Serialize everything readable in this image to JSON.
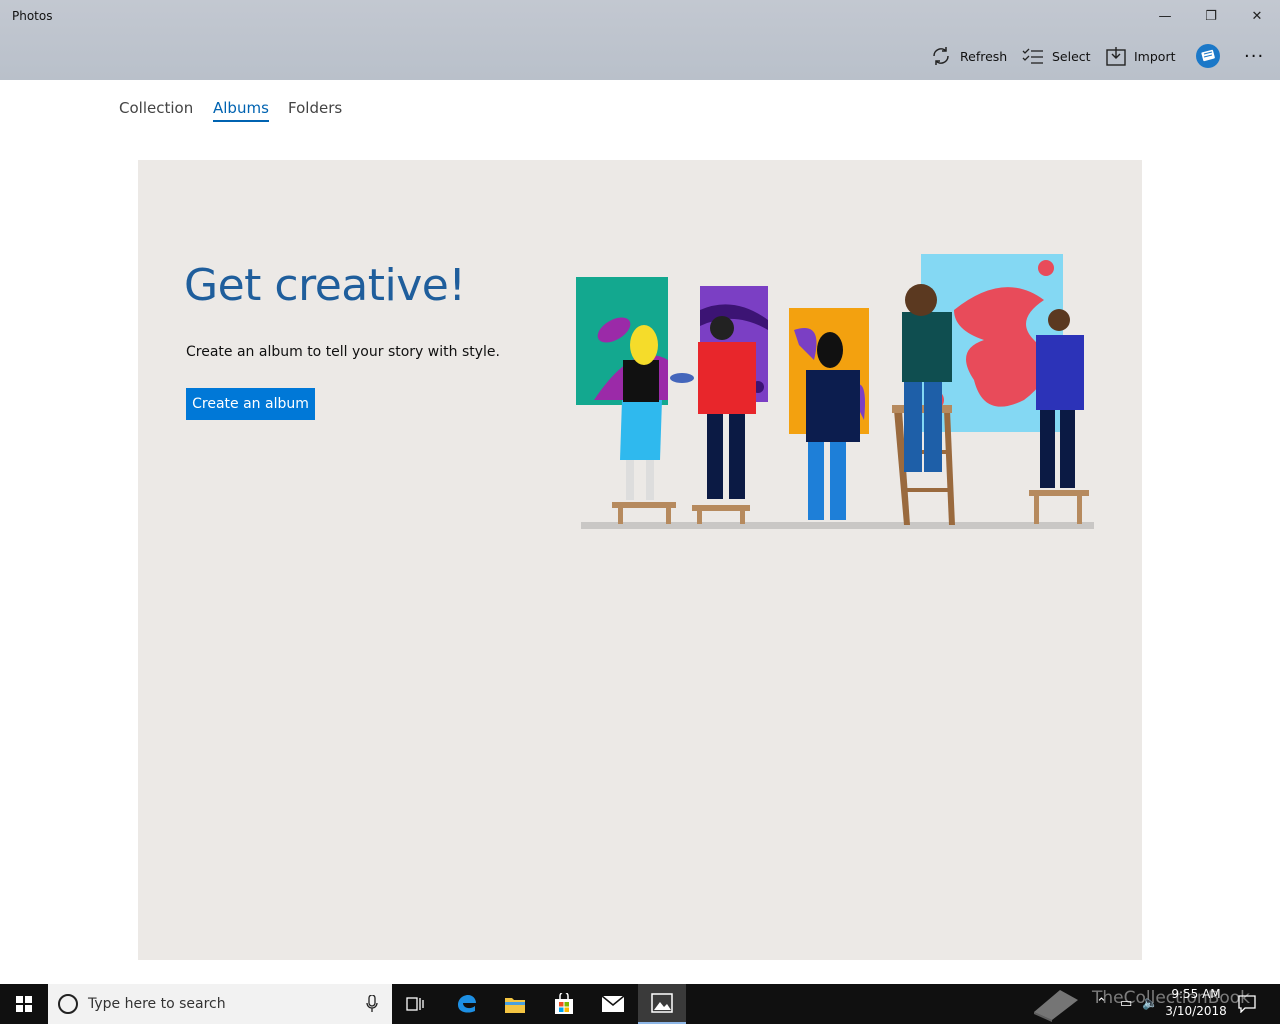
{
  "window": {
    "title": "Photos",
    "minimize_glyph": "—",
    "maximize_glyph": "❐",
    "close_glyph": "✕"
  },
  "toolbar": {
    "refresh_label": "Refresh",
    "select_label": "Select",
    "import_label": "Import",
    "more_glyph": "···"
  },
  "nav": {
    "tabs": [
      {
        "label": "Collection",
        "active": false
      },
      {
        "label": "Albums",
        "active": true
      },
      {
        "label": "Folders",
        "active": false
      }
    ]
  },
  "hero": {
    "title": "Get creative!",
    "subtitle": "Create an album to tell your story with style.",
    "button_label": "Create an album"
  },
  "taskbar": {
    "search_placeholder": "Type here to search",
    "time": "9:55 AM",
    "date": "3/10/2018",
    "watermark": "TheCollectionBook",
    "apps": [
      "task-view-icon",
      "edge-icon",
      "file-explorer-icon",
      "store-icon",
      "mail-icon",
      "photos-icon"
    ]
  },
  "colors": {
    "accent": "#0078d7",
    "tab_active": "#0063b1",
    "title_blue": "#1f5e9c",
    "card_bg": "#ece9e6",
    "titlebar": "#bfc5ce"
  }
}
